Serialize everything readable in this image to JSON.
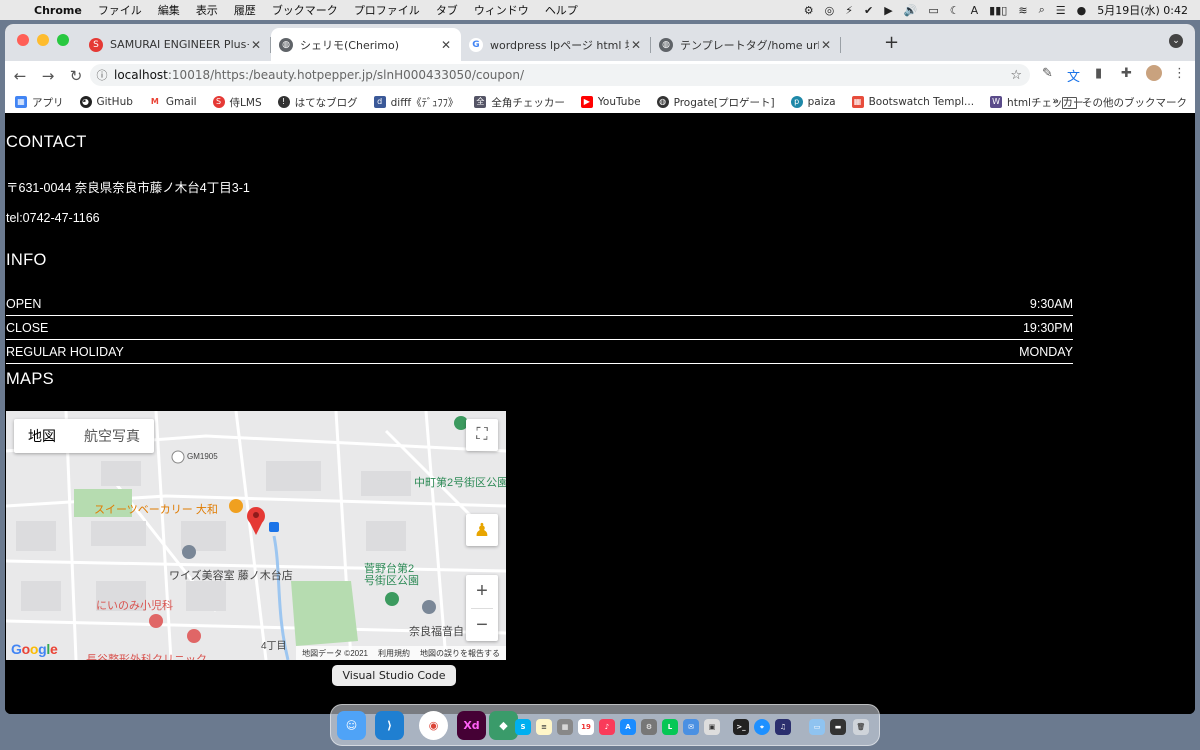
{
  "menubar": {
    "app_name": "Chrome",
    "items": [
      "ファイル",
      "編集",
      "表示",
      "履歴",
      "ブックマーク",
      "プロファイル",
      "タブ",
      "ウィンドウ",
      "ヘルプ"
    ],
    "clock": "5月19日(水)  0:42"
  },
  "tabs": [
    {
      "title": "SAMURAI ENGINEER Plus+ - Et",
      "favicon": "samurai-icon",
      "color": "#e53935"
    },
    {
      "title": "シェリモ(Cherimo)",
      "favicon": "globe-icon",
      "color": "#5f6368",
      "active": true
    },
    {
      "title": "wordpress lpページ html 埋め込み",
      "favicon": "google-icon",
      "color": "#4285f4"
    },
    {
      "title": "テンプレートタグ/home url - Wor",
      "favicon": "globe-icon",
      "color": "#5f6368"
    }
  ],
  "address": {
    "host": "localhost",
    "path": ":10018/https:/beauty.hotpepper.jp/slnH000433050/coupon/"
  },
  "bookmarks": [
    {
      "label": "アプリ",
      "color": "#4285f4"
    },
    {
      "label": "GitHub",
      "color": "#222"
    },
    {
      "label": "Gmail",
      "color": "#ea4335"
    },
    {
      "label": "侍LMS",
      "color": "#e53935"
    },
    {
      "label": "はてなブログ",
      "color": "#333"
    },
    {
      "label": "difff《ﾃﾞｭﾌﾌ》",
      "color": "#3b5998"
    },
    {
      "label": "全角チェッカー",
      "color": "#556"
    },
    {
      "label": "YouTube",
      "color": "#ff0000"
    },
    {
      "label": "Progate[プロゲート]",
      "color": "#333"
    },
    {
      "label": "paiza",
      "color": "#1e88a8"
    },
    {
      "label": "Bootswatch Templ...",
      "color": "#e74c3c"
    },
    {
      "label": "htmlチェッカー",
      "color": "#5a4b8a"
    }
  ],
  "bookmarks_more": "»",
  "bookmarks_other": "その他のブックマーク",
  "page": {
    "contact_heading": "CONTACT",
    "address": "〒631-0044 奈良県奈良市藤ノ木台4丁目3-1",
    "tel": "tel:0742-47-1166",
    "info_heading": "INFO",
    "info_rows": [
      {
        "label": "OPEN",
        "value": "9:30AM"
      },
      {
        "label": "CLOSE",
        "value": "19:30PM"
      },
      {
        "label": "REGULAR HOLIDAY",
        "value": "MONDAY"
      }
    ],
    "maps_heading": "MAPS"
  },
  "map": {
    "map_button": "地図",
    "satellite_button": "航空写真",
    "labels": {
      "gm": "GM1905",
      "bakery": "スイーツベーカリー 大和",
      "salon": "ワイズ美容室 藤ノ木台店",
      "park1": "中町第2号街区公園",
      "park2": "菅野台第2\n号街区公園",
      "clinic": "にいのみ小児科",
      "church": "奈良福音自",
      "area": "4丁目",
      "ortho": "長谷整形外科クリニック"
    },
    "footer": [
      "地図データ ©2021",
      "利用規約",
      "地図の誤りを報告する"
    ],
    "zoom_in": "+",
    "zoom_out": "−"
  },
  "dock": {
    "tooltip": "Visual Studio Code"
  }
}
